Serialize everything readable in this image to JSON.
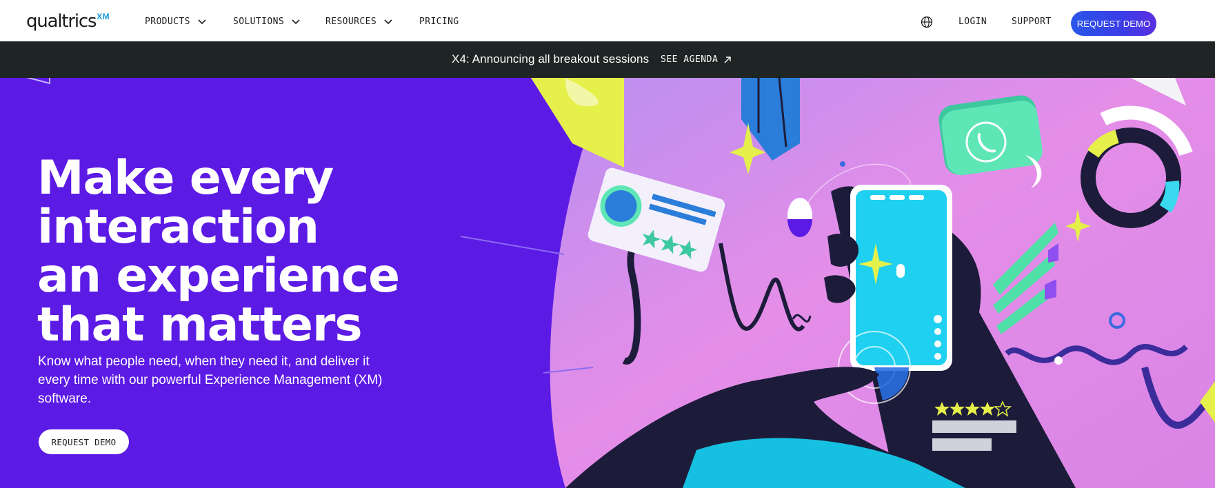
{
  "brand": {
    "name": "qualtrics",
    "suffix": "XM"
  },
  "nav": {
    "items": [
      {
        "label": "PRODUCTS",
        "has_dropdown": true
      },
      {
        "label": "SOLUTIONS",
        "has_dropdown": true
      },
      {
        "label": "RESOURCES",
        "has_dropdown": true
      },
      {
        "label": "PRICING",
        "has_dropdown": false
      }
    ],
    "language_icon": "globe-icon",
    "login_label": "LOGIN",
    "support_label": "SUPPORT",
    "cta_label": "REQUEST DEMO"
  },
  "announcement": {
    "text": "X4: Announcing all breakout sessions",
    "link_label": "SEE AGENDA",
    "link_icon": "arrow-up-right-icon"
  },
  "hero": {
    "title_lines": [
      "Make every",
      "interaction",
      "an experience",
      "that matters"
    ],
    "subtitle": "Know what people need, when they need it, and deliver it every time with our powerful Experience Management (XM) software.",
    "cta_label": "REQUEST DEMO",
    "rating_stars": 4,
    "rating_max": 5
  },
  "colors": {
    "hero_bg": "#5c1ae5",
    "announce_bg": "#1f2424",
    "cta_gradient_start": "#2956e8",
    "cta_gradient_end": "#5b2fe2",
    "art_pink": "#e28ce8",
    "art_cyan": "#1fd0f0",
    "art_navy": "#1c1c3a",
    "art_yellow": "#e6f04a",
    "art_green": "#4fe0a8"
  }
}
